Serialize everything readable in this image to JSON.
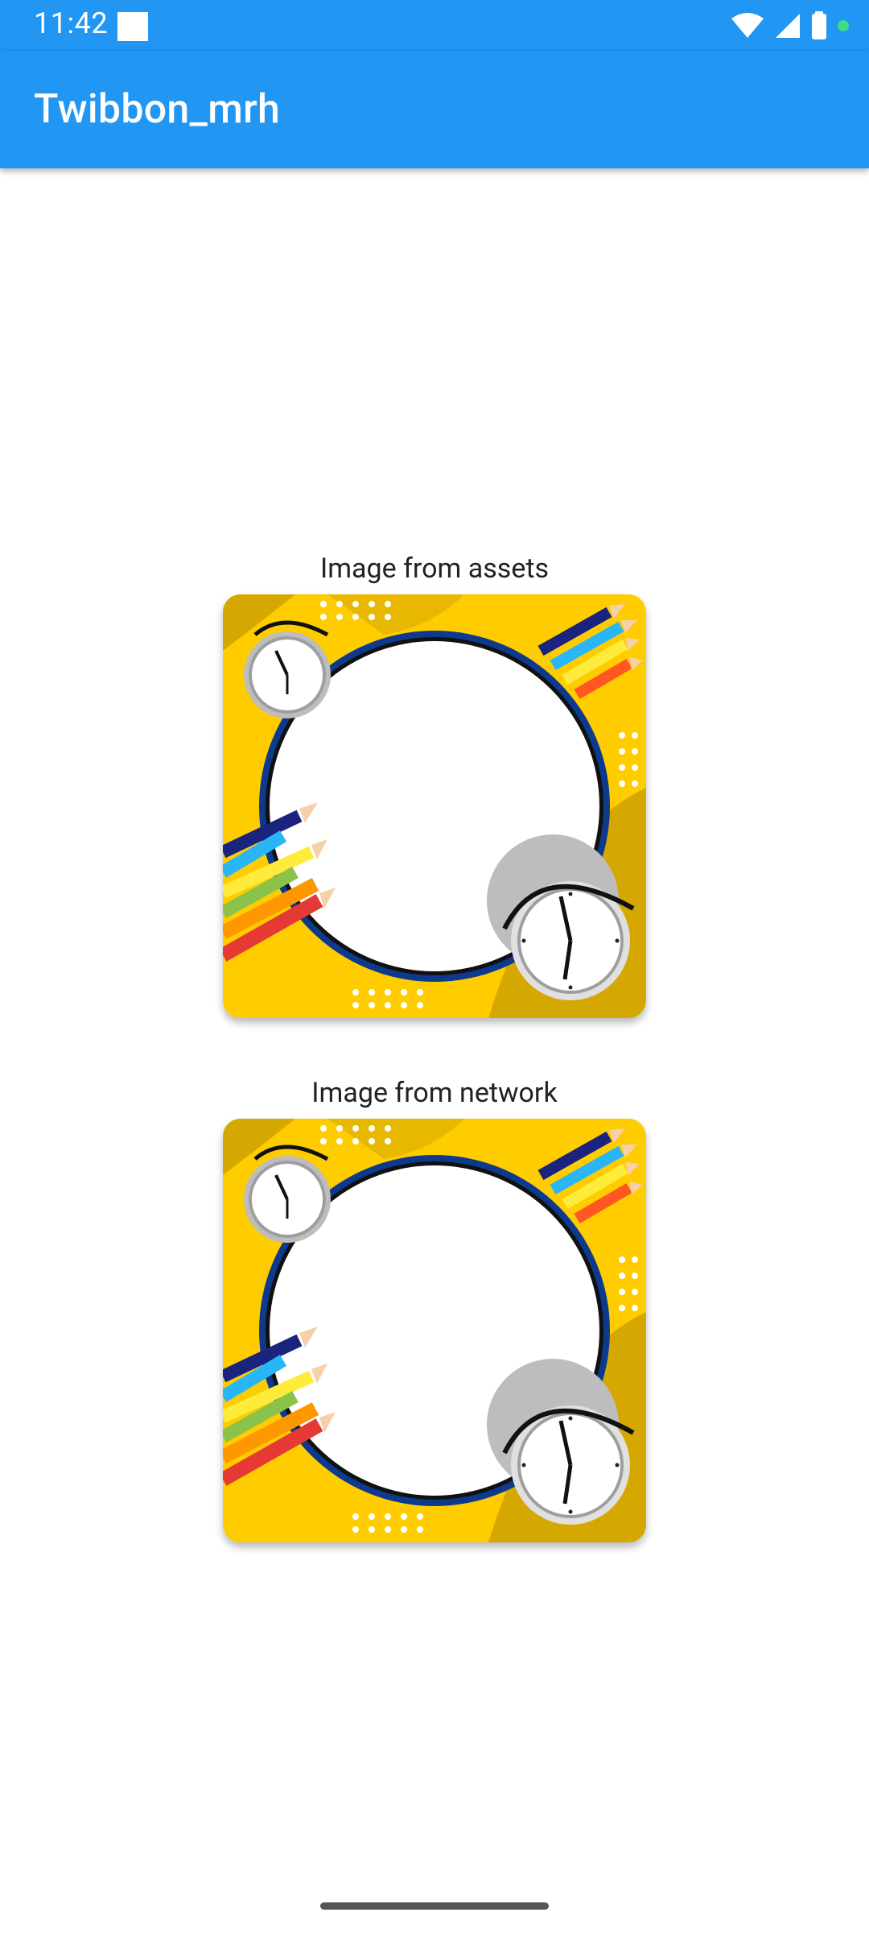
{
  "status_bar": {
    "time": "11:42",
    "icons": [
      "notification-square-icon",
      "wifi-icon",
      "signal-icon",
      "battery-icon",
      "green-dot-icon"
    ]
  },
  "app_bar": {
    "title": "Twibbon_mrh",
    "color": "#2196F3"
  },
  "main": {
    "images": [
      {
        "label": "Image from assets",
        "image": "twibbon-frame"
      },
      {
        "label": "Image from network",
        "image": "twibbon-frame"
      }
    ]
  },
  "colors": {
    "frame_yellow": "#FFCC00",
    "frame_dark_yellow": "#D4A800",
    "ring_blue": "#0D3A8C"
  }
}
